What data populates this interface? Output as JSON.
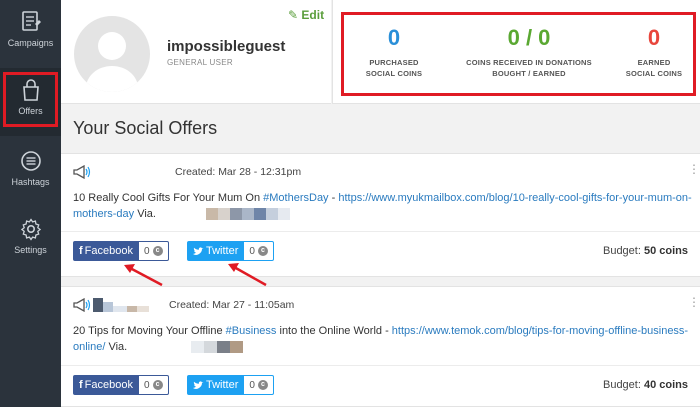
{
  "sidebar": {
    "items": [
      {
        "label": "Campaigns",
        "icon": "document-icon"
      },
      {
        "label": "Offers",
        "icon": "shopping-bag-icon"
      },
      {
        "label": "Hashtags",
        "icon": "menu-circle-icon"
      },
      {
        "label": "Settings",
        "icon": "gear-icon"
      }
    ]
  },
  "profile": {
    "username": "impossibleguest",
    "role": "GENERAL USER",
    "edit_label": "Edit"
  },
  "stats": [
    {
      "value": "0",
      "caption_line1": "PURCHASED",
      "caption_line2": "SOCIAL COINS",
      "color": "#2a8fd8"
    },
    {
      "value": "0 / 0",
      "caption_line1": "COINS RECEIVED IN DONATIONS",
      "caption_line2": "BOUGHT / EARNED",
      "color": "#5aa832"
    },
    {
      "value": "0",
      "caption_line1": "EARNED",
      "caption_line2": "SOCIAL COINS",
      "color": "#e8463c"
    }
  ],
  "section_title": "Your Social Offers",
  "offers": [
    {
      "created": "Created: Mar 28 - 12:31pm",
      "text_before": "10 Really Cool Gifts For Your Mum On ",
      "hashtag": "#MothersDay",
      "text_mid": " - ",
      "url": "https://www.myukmailbox.com/blog/10-really-cool-gifts-for-your-mum-on-mothers-day",
      "via": " Via. ",
      "facebook_label": "Facebook",
      "facebook_count": "0",
      "twitter_label": "Twitter",
      "twitter_count": "0",
      "budget_label": "Budget:",
      "budget_value": "50 coins"
    },
    {
      "created": "Created: Mar 27 - 11:05am",
      "text_before": "20 Tips for Moving Your Offline ",
      "hashtag": "#Business",
      "text_mid": " into the Online World - ",
      "url": "https://www.temok.com/blog/tips-for-moving-offline-business-online/",
      "via": " Via. ",
      "facebook_label": "Facebook",
      "facebook_count": "0",
      "twitter_label": "Twitter",
      "twitter_count": "0",
      "budget_label": "Budget:",
      "budget_value": "40 coins"
    }
  ],
  "colors": {
    "accent": "#e01b24",
    "facebook": "#3b5998",
    "twitter": "#1da1f2",
    "edit": "#5a9e3b"
  }
}
